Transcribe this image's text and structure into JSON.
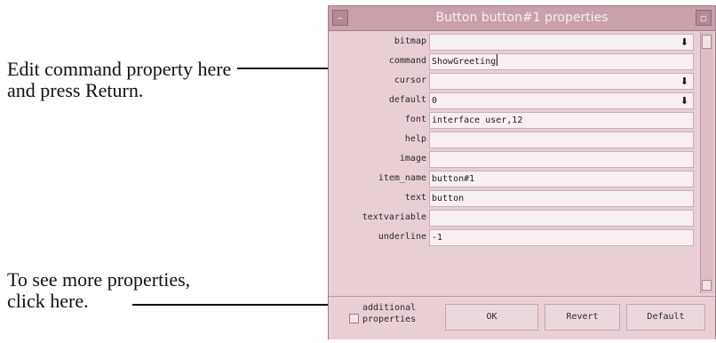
{
  "callouts": {
    "edit_command": [
      "Edit command property here",
      "and press Return."
    ],
    "more_properties": [
      "To see more properties,",
      " click here."
    ]
  },
  "window": {
    "title": "Button button#1 properties",
    "menu_icon": "minus-icon",
    "maximize_icon": "square-icon"
  },
  "properties": [
    {
      "label": "bitmap",
      "value": "",
      "type": "dropdown"
    },
    {
      "label": "command",
      "value": "ShowGreeting",
      "type": "text",
      "active": true
    },
    {
      "label": "cursor",
      "value": "",
      "type": "dropdown"
    },
    {
      "label": "default",
      "value": "0",
      "type": "dropdown"
    },
    {
      "label": "font",
      "value": "interface user,12",
      "type": "text"
    },
    {
      "label": "help",
      "value": "",
      "type": "text"
    },
    {
      "label": "image",
      "value": "",
      "type": "text"
    },
    {
      "label": "item_name",
      "value": "button#1",
      "type": "text"
    },
    {
      "label": "text",
      "value": "button",
      "type": "text"
    },
    {
      "label": "textvariable",
      "value": "",
      "type": "text"
    },
    {
      "label": "underline",
      "value": "-1",
      "type": "text"
    }
  ],
  "bottom": {
    "additional_properties": [
      "additional",
      "properties"
    ],
    "ok_label": "OK",
    "revert_label": "Revert",
    "default_label": "Default"
  },
  "icons": {
    "dropdown": "down-arrow-icon"
  },
  "colors": {
    "window_background": "#e7cfd4",
    "title_bar": "#caa1ab",
    "field_background": "#f7eff1",
    "callout_text": "#111111"
  }
}
